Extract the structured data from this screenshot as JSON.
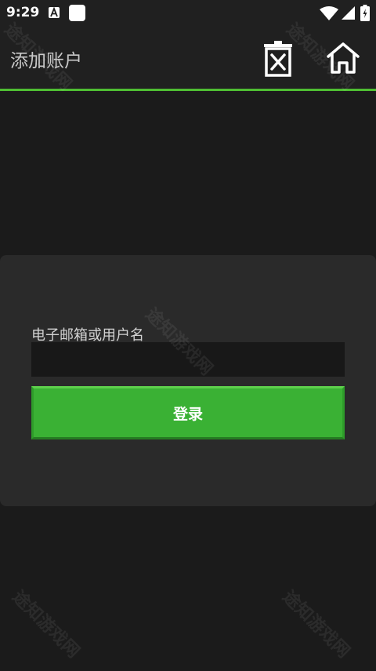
{
  "status_bar": {
    "time": "9:29",
    "icons": [
      "accessibility-a-icon",
      "app-square-icon",
      "wifi-icon",
      "cell-signal-icon",
      "battery-charging-icon"
    ]
  },
  "app_bar": {
    "title": "添加账户",
    "actions": [
      "delete-icon",
      "home-icon"
    ],
    "divider_color": "#4fbe33"
  },
  "form": {
    "username_label": "电子邮箱或用户名",
    "username_value": "",
    "login_label": "登录",
    "button_color": "#3ab134"
  },
  "watermark": {
    "text": "途知游戏网"
  }
}
